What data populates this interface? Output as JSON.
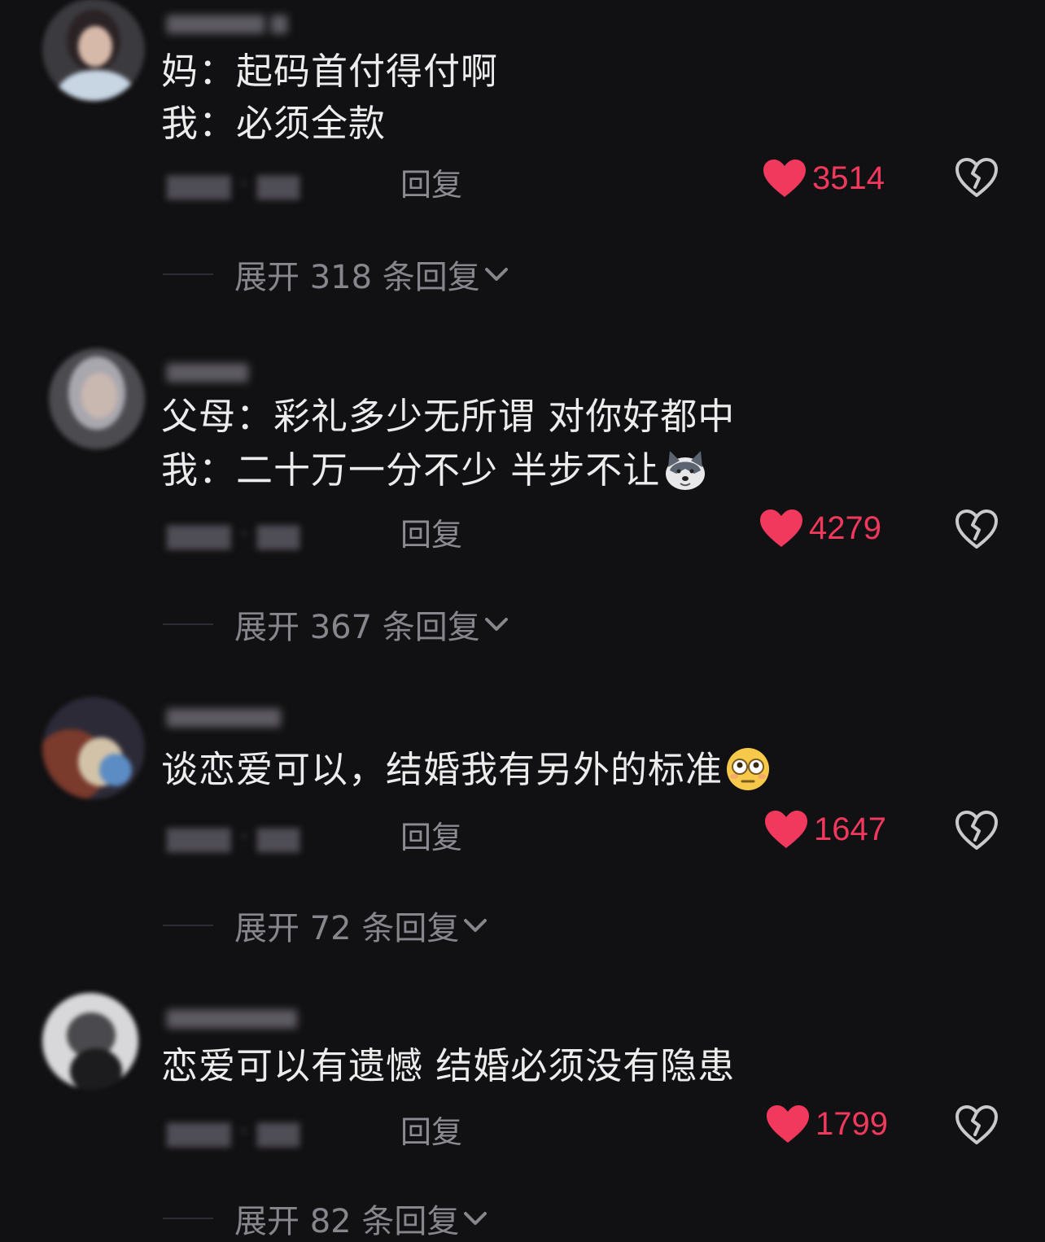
{
  "colors": {
    "background": "#111012",
    "text": "#ececec",
    "like_red": "#f0395c",
    "muted": "#8d8b92"
  },
  "comments": [
    {
      "lines": [
        "妈：起码首付得付啊",
        "我：必须全款"
      ],
      "reply_label": "回复",
      "likes": "3514",
      "expand_label": "展开 318 条回复"
    },
    {
      "lines": [
        "父母：彩礼多少无所谓 对你好都中",
        "我：二十万一分不少 半步不让"
      ],
      "emoji": "dog-face-emoji",
      "reply_label": "回复",
      "likes": "4279",
      "expand_label": "展开 367 条回复"
    },
    {
      "lines": [
        "谈恋爱可以，结婚我有另外的标准"
      ],
      "emoji": "flushed-eyes-emoji",
      "reply_label": "回复",
      "likes": "1647",
      "expand_label": "展开 72 条回复"
    },
    {
      "lines": [
        "恋爱可以有遗憾  结婚必须没有隐患"
      ],
      "reply_label": "回复",
      "likes": "1799",
      "expand_label": "展开 82 条回复"
    }
  ]
}
